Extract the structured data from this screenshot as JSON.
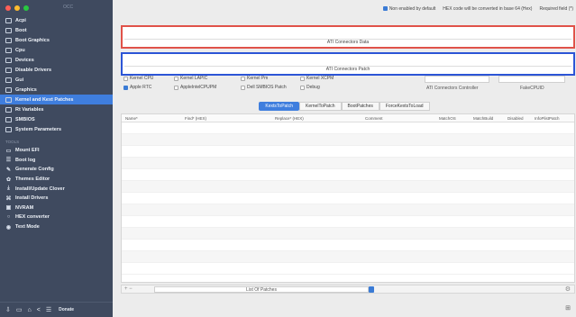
{
  "sidebar": {
    "app_title": "OCC",
    "items": [
      {
        "label": "Acpi"
      },
      {
        "label": "Boot"
      },
      {
        "label": "Boot Graphics"
      },
      {
        "label": "Cpu"
      },
      {
        "label": "Devices"
      },
      {
        "label": "Disable Drivers"
      },
      {
        "label": "Gui"
      },
      {
        "label": "Graphics"
      },
      {
        "label": "Kernel and Kext Patches"
      },
      {
        "label": "Rt Variables"
      },
      {
        "label": "SMBIOS"
      },
      {
        "label": "System Parameters"
      }
    ],
    "tools_section": "TOOLS",
    "tools": [
      {
        "label": "Mount EFI",
        "icon": "drive-icon",
        "glyph": "▭"
      },
      {
        "label": "Boot log",
        "icon": "list-icon",
        "glyph": "☰"
      },
      {
        "label": "Generate Config",
        "icon": "wand-icon",
        "glyph": "✎"
      },
      {
        "label": "Themes Editor",
        "icon": "brush-icon",
        "glyph": "✿"
      },
      {
        "label": "Install/Update Clover",
        "icon": "download-icon",
        "glyph": "⤓"
      },
      {
        "label": "Install Drivers",
        "icon": "puzzle-icon",
        "glyph": "⌘"
      },
      {
        "label": "NVRAM",
        "icon": "chip-icon",
        "glyph": "▣"
      },
      {
        "label": "HEX converter",
        "icon": "hex-icon",
        "glyph": "○"
      },
      {
        "label": "Text Mode",
        "icon": "text-icon",
        "glyph": "◉"
      }
    ],
    "bottom": {
      "donate_label": "Donate"
    }
  },
  "topbar": {
    "disabled_default": "Non enabled by default",
    "hex_note": "HEX code will be converted in base 64 (Hex)",
    "required": "Required field (*)"
  },
  "ati_connectors_data": {
    "label": "ATI Connectors Data"
  },
  "ati_connectors_patch": {
    "label": "ATI Connectors Patch"
  },
  "options": {
    "kernel_cpu": "Kernel CPU",
    "kernel_lapic": "Kernel LAPIC",
    "kernel_pm": "Kernel Pm",
    "kernel_xcpm": "Kernel XCPM",
    "apple_rtc": "Apple RTC",
    "asus_aicpupm": "AppleIntelCPUPM",
    "dell_smbios": "Dell SMBIOS Patch",
    "debug": "Debug",
    "ati_connectors_controller": "ATI Connectors Controller",
    "fake_cpuid": "FakeCPUID"
  },
  "tabs": [
    {
      "label": "KextsToPatch",
      "active": true
    },
    {
      "label": "KernelToPatch",
      "active": false
    },
    {
      "label": "BootPatches",
      "active": false
    },
    {
      "label": "ForceKextsToLoad",
      "active": false
    }
  ],
  "table": {
    "headers": [
      "Name*",
      "Find* (HEX)",
      "Replace* (HEX)",
      "Comment",
      "MatchOS",
      "MatchBuild",
      "Disabled",
      "InfoPlistPatch"
    ]
  },
  "footer": {
    "controls": "+ −",
    "list_label": "List Of Patches"
  }
}
